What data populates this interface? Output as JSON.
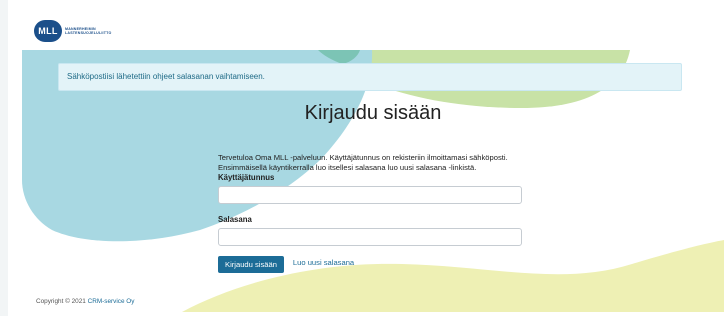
{
  "header": {
    "logo_mark": "MLL",
    "logo_text_line1": "MANNERHEIMIN",
    "logo_text_line2": "LASTENSUOJELULIITTO"
  },
  "alert": {
    "message": "Sähköpostiisi lähetettiin ohjeet salasanan vaihtamiseen."
  },
  "login": {
    "title": "Kirjaudu sisään",
    "intro_line1": "Tervetuloa Oma MLL -palveluun. Käyttäjätunnus on rekisteriin ilmoittamasi sähköposti.",
    "intro_line2": "Ensimmäisellä käyntikerralla luo itsellesi salasana luo uusi salasana -linkistä.",
    "username_label": "Käyttäjätunnus",
    "username_value": "",
    "password_label": "Salasana",
    "password_value": "",
    "submit_label": "Kirjaudu sisään",
    "new_password_link": "Luo uusi salasana"
  },
  "footer": {
    "copyright": "Copyright © 2021",
    "company": "CRM-service Oy"
  },
  "colors": {
    "brand": "#1b4f8a",
    "button": "#1c6c97",
    "blob_blue": "#a8d8e2",
    "blob_green": "#c8e2a6",
    "blob_yellow": "#eef0b4"
  }
}
